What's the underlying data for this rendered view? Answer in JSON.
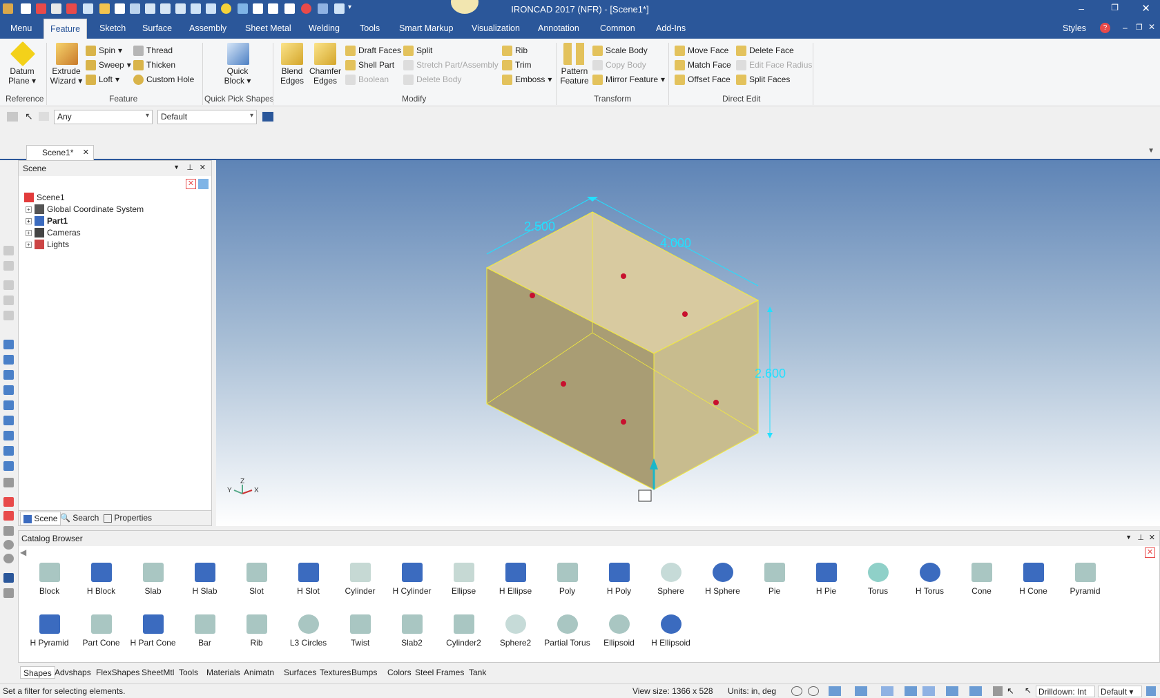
{
  "app": {
    "title": "IRONCAD 2017 (NFR) - [Scene1*]"
  },
  "menu": {
    "tabs": [
      "Menu",
      "Feature",
      "Sketch",
      "Surface",
      "Assembly",
      "Sheet Metal",
      "Welding",
      "Tools",
      "Smart Markup",
      "Visualization",
      "Annotation",
      "Common",
      "Add-Ins"
    ],
    "styles": "Styles"
  },
  "ribbon": {
    "reference": {
      "datum_plane": "Datum Plane ▾",
      "group": "Reference"
    },
    "feature": {
      "extrude": "Extrude Wizard ▾",
      "spin": "Spin",
      "sweep": "Sweep",
      "loft": "Loft",
      "thread": "Thread",
      "thicken": "Thicken",
      "custom_hole": "Custom Hole",
      "group": "Feature"
    },
    "quick": {
      "quick_block": "Quick Block ▾",
      "group": "Quick Pick Shapes"
    },
    "modify": {
      "blend": "Blend Edges",
      "chamfer": "Chamfer Edges",
      "draft": "Draft Faces",
      "shell": "Shell Part",
      "boolean": "Boolean",
      "split": "Split",
      "stretch": "Stretch Part/Assembly",
      "delete_body": "Delete Body",
      "rib": "Rib",
      "trim": "Trim",
      "emboss": "Emboss",
      "group": "Modify"
    },
    "transform": {
      "pattern": "Pattern Feature",
      "scale": "Scale Body",
      "copy": "Copy Body",
      "mirror": "Mirror Feature",
      "group": "Transform"
    },
    "direct": {
      "move_face": "Move Face",
      "match_face": "Match Face",
      "offset_face": "Offset Face",
      "delete_face": "Delete Face",
      "edit_radius": "Edit Face Radius",
      "split_faces": "Split Faces",
      "group": "Direct Edit"
    }
  },
  "selection": {
    "filter": "Any",
    "config": "Default"
  },
  "doc_tab": "Scene1*",
  "scene": {
    "title": "Scene",
    "items": [
      {
        "label": "Scene1"
      },
      {
        "label": "Global Coordinate System"
      },
      {
        "label": "Part1"
      },
      {
        "label": "Cameras"
      },
      {
        "label": "Lights"
      }
    ],
    "tabs": [
      "Scene",
      "Search",
      "Properties"
    ]
  },
  "viewport": {
    "dims": [
      "2.500",
      "4.000",
      "2.600"
    ],
    "axes": [
      "Z",
      "Y",
      "X"
    ]
  },
  "catalog": {
    "title": "Catalog Browser",
    "items": [
      "Block",
      "H Block",
      "Slab",
      "H Slab",
      "Slot",
      "H Slot",
      "Cylinder",
      "H Cylinder",
      "Ellipse",
      "H Ellipse",
      "Poly",
      "H Poly",
      "Sphere",
      "H Sphere",
      "Pie",
      "H Pie",
      "Torus",
      "H Torus",
      "Cone",
      "H Cone",
      "Pyramid",
      "H Pyramid",
      "Part Cone",
      "H Part Cone",
      "Bar",
      "Rib",
      "L3 Circles",
      "Twist",
      "Slab2",
      "Cylinder2",
      "Sphere2",
      "Partial Torus",
      "Ellipsoid",
      "H Ellipsoid"
    ],
    "tabs": [
      "Shapes",
      "Advshaps",
      "FlexShapes",
      "SheetMtl",
      "Tools",
      "Materials",
      "Animatn",
      "Surfaces",
      "Textures",
      "Bumps",
      "Colors",
      "Steel Frames",
      "Tank"
    ]
  },
  "status": {
    "message": "Set a filter for selecting elements.",
    "view_size": "View size: 1366 x 528",
    "units": "Units: in, deg",
    "drilldown": "Drilldown: Int",
    "config": "Default"
  },
  "colors": {
    "accent": "#2b579a",
    "part_face": "#cdbf8e",
    "dimension": "#22e0ff"
  }
}
